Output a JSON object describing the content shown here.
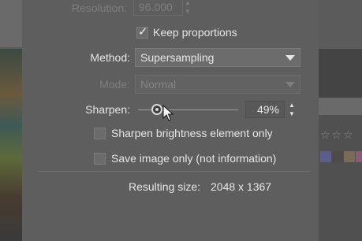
{
  "resolution": {
    "label": "Resolution:",
    "value": "96.000"
  },
  "keep_proportions": {
    "label": "Keep proportions",
    "checked": true
  },
  "method": {
    "label": "Method:",
    "selected": "Supersampling"
  },
  "mode": {
    "label": "Mode:",
    "selected": "Normal"
  },
  "sharpen": {
    "label": "Sharpen:",
    "value_text": "49%",
    "level": 49
  },
  "sharpen_brightness": {
    "label": "Sharpen brightness element only",
    "checked": false
  },
  "save_image_only": {
    "label": "Save image only (not information)",
    "checked": false
  },
  "result": {
    "label": "Resulting size:",
    "value": "2048 x 1367"
  },
  "background": {
    "rating_stars": "☆☆☆",
    "swatch_colors": [
      "#5b5e8a",
      "#4e4a4a",
      "#7a6a58",
      "#8a5a7a",
      "#7a5a6a"
    ]
  }
}
